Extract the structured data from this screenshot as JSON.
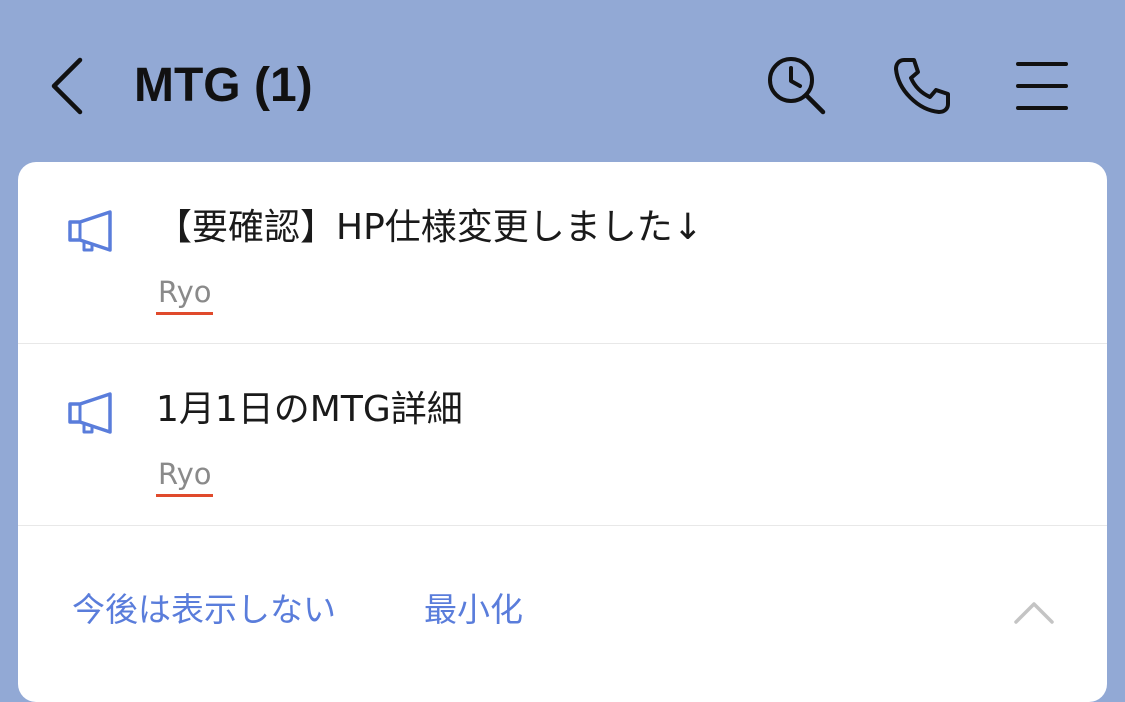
{
  "header": {
    "title": "MTG (1)",
    "back_icon": "chevron-left-icon",
    "search_icon": "search-history-icon",
    "call_icon": "phone-icon",
    "menu_icon": "hamburger-menu-icon"
  },
  "announcements": [
    {
      "icon": "megaphone-icon",
      "message": "【要確認】HP仕様変更しました↓",
      "author": "Ryo"
    },
    {
      "icon": "megaphone-icon",
      "message": "1月1日のMTG詳細",
      "author": "Ryo"
    }
  ],
  "footer": {
    "hide_label": "今後は表示しない",
    "minimize_label": "最小化",
    "collapse_icon": "chevron-up-icon"
  },
  "colors": {
    "background": "#92a9d5",
    "card": "#ffffff",
    "accent": "#5a7ddb",
    "author_underline": "#e04a2c"
  }
}
